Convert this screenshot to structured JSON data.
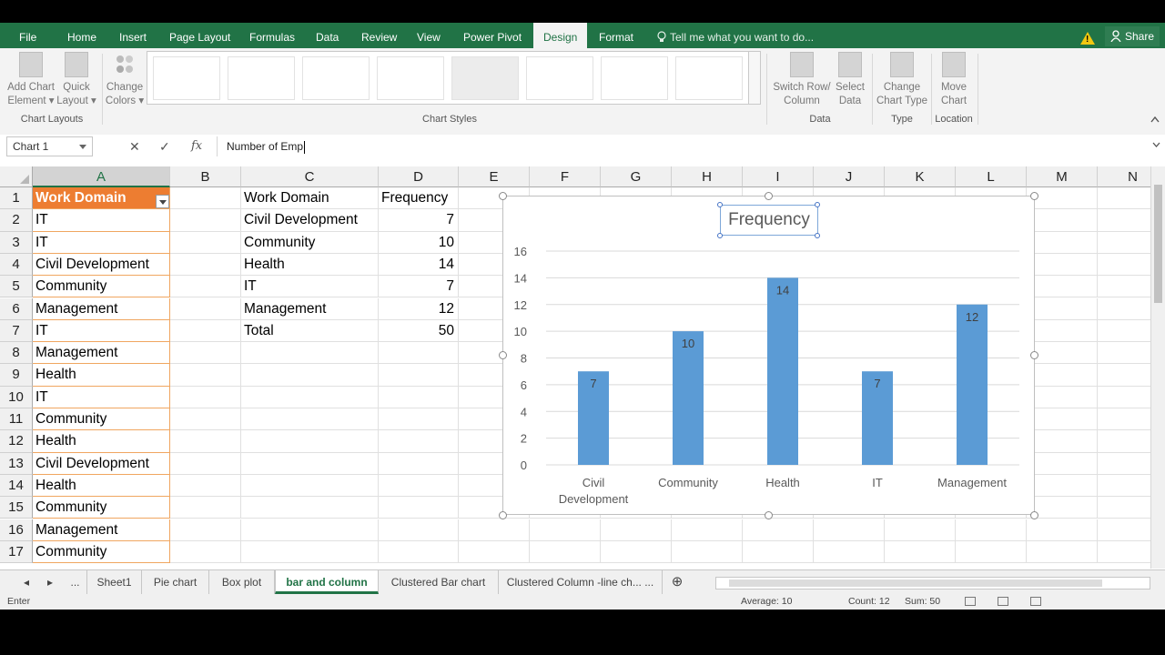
{
  "ribbon_tabs": [
    "File",
    "Home",
    "Insert",
    "Page Layout",
    "Formulas",
    "Data",
    "Review",
    "View",
    "Power Pivot",
    "Design",
    "Format"
  ],
  "active_tab": "Design",
  "tell_me": "Tell me what you want to do...",
  "share_label": "Share",
  "warning_glyph": "!",
  "ribbon": {
    "add_chart_element": [
      "Add Chart",
      "Element ▾"
    ],
    "quick_layout": [
      "Quick",
      "Layout ▾"
    ],
    "change_colors": [
      "Change",
      "Colors ▾"
    ],
    "chart_layouts_group": "Chart Layouts",
    "chart_styles_group": "Chart Styles",
    "switch_row_column": [
      "Switch Row/",
      "Column"
    ],
    "select_data": [
      "Select",
      "Data"
    ],
    "data_group": "Data",
    "change_chart_type": [
      "Change",
      "Chart Type"
    ],
    "type_group": "Type",
    "move_chart": [
      "Move",
      "Chart"
    ],
    "location_group": "Location"
  },
  "formula_bar": {
    "name_box": "Chart 1",
    "cancel": "✕",
    "enter": "✓",
    "fx": "fx",
    "content": "Number of Emp"
  },
  "columns": [
    "A",
    "B",
    "C",
    "D",
    "E",
    "F",
    "G",
    "H",
    "I",
    "J",
    "K",
    "L",
    "M",
    "N"
  ],
  "rows": [
    "1",
    "2",
    "3",
    "4",
    "5",
    "6",
    "7",
    "8",
    "9",
    "10",
    "11",
    "12",
    "13",
    "14",
    "15",
    "16",
    "17"
  ],
  "column_a": [
    "Work Domain",
    "IT",
    "IT",
    "Civil Development",
    "Community",
    "Management",
    "IT",
    "Management",
    "Health",
    "IT",
    "Community",
    "Health",
    "Civil Development",
    "Health",
    "Community",
    "Management",
    "Community"
  ],
  "summary_table": {
    "header": [
      "Work Domain",
      "Frequency"
    ],
    "rows": [
      [
        "Civil Development",
        "7"
      ],
      [
        "Community",
        "10"
      ],
      [
        "Health",
        "14"
      ],
      [
        "IT",
        "7"
      ],
      [
        "Management",
        "12"
      ],
      [
        "Total",
        "50"
      ]
    ]
  },
  "chart_data": {
    "type": "bar",
    "title": "Frequency",
    "categories": [
      "Civil Development",
      "Community",
      "Health",
      "IT",
      "Management"
    ],
    "category_labels": [
      [
        "Civil",
        "Development"
      ],
      [
        "Community"
      ],
      [
        "Health"
      ],
      [
        "IT"
      ],
      [
        "Management"
      ]
    ],
    "values": [
      7,
      10,
      14,
      7,
      12
    ],
    "ylim": [
      0,
      16
    ],
    "yticks": [
      "0",
      "2",
      "4",
      "6",
      "8",
      "10",
      "12",
      "14",
      "16"
    ],
    "grid": true,
    "legend": "none",
    "bar_color": "#5b9bd5"
  },
  "sheet_nav": [
    "◂",
    "▸",
    "..."
  ],
  "sheet_tabs": [
    "Sheet1",
    "Pie chart",
    "Box plot",
    "bar and column",
    "Clustered Bar chart",
    "Clustered Column -line ch... ..."
  ],
  "active_sheet": "bar and column",
  "add_sheet": "⊕",
  "status": {
    "mode": "Enter",
    "average": "Average: 10",
    "count": "Count: 12",
    "sum": "Sum: 50"
  },
  "colors": {
    "accent": "#217346",
    "table_header": "#ed7d31",
    "bar": "#5b9bd5"
  }
}
